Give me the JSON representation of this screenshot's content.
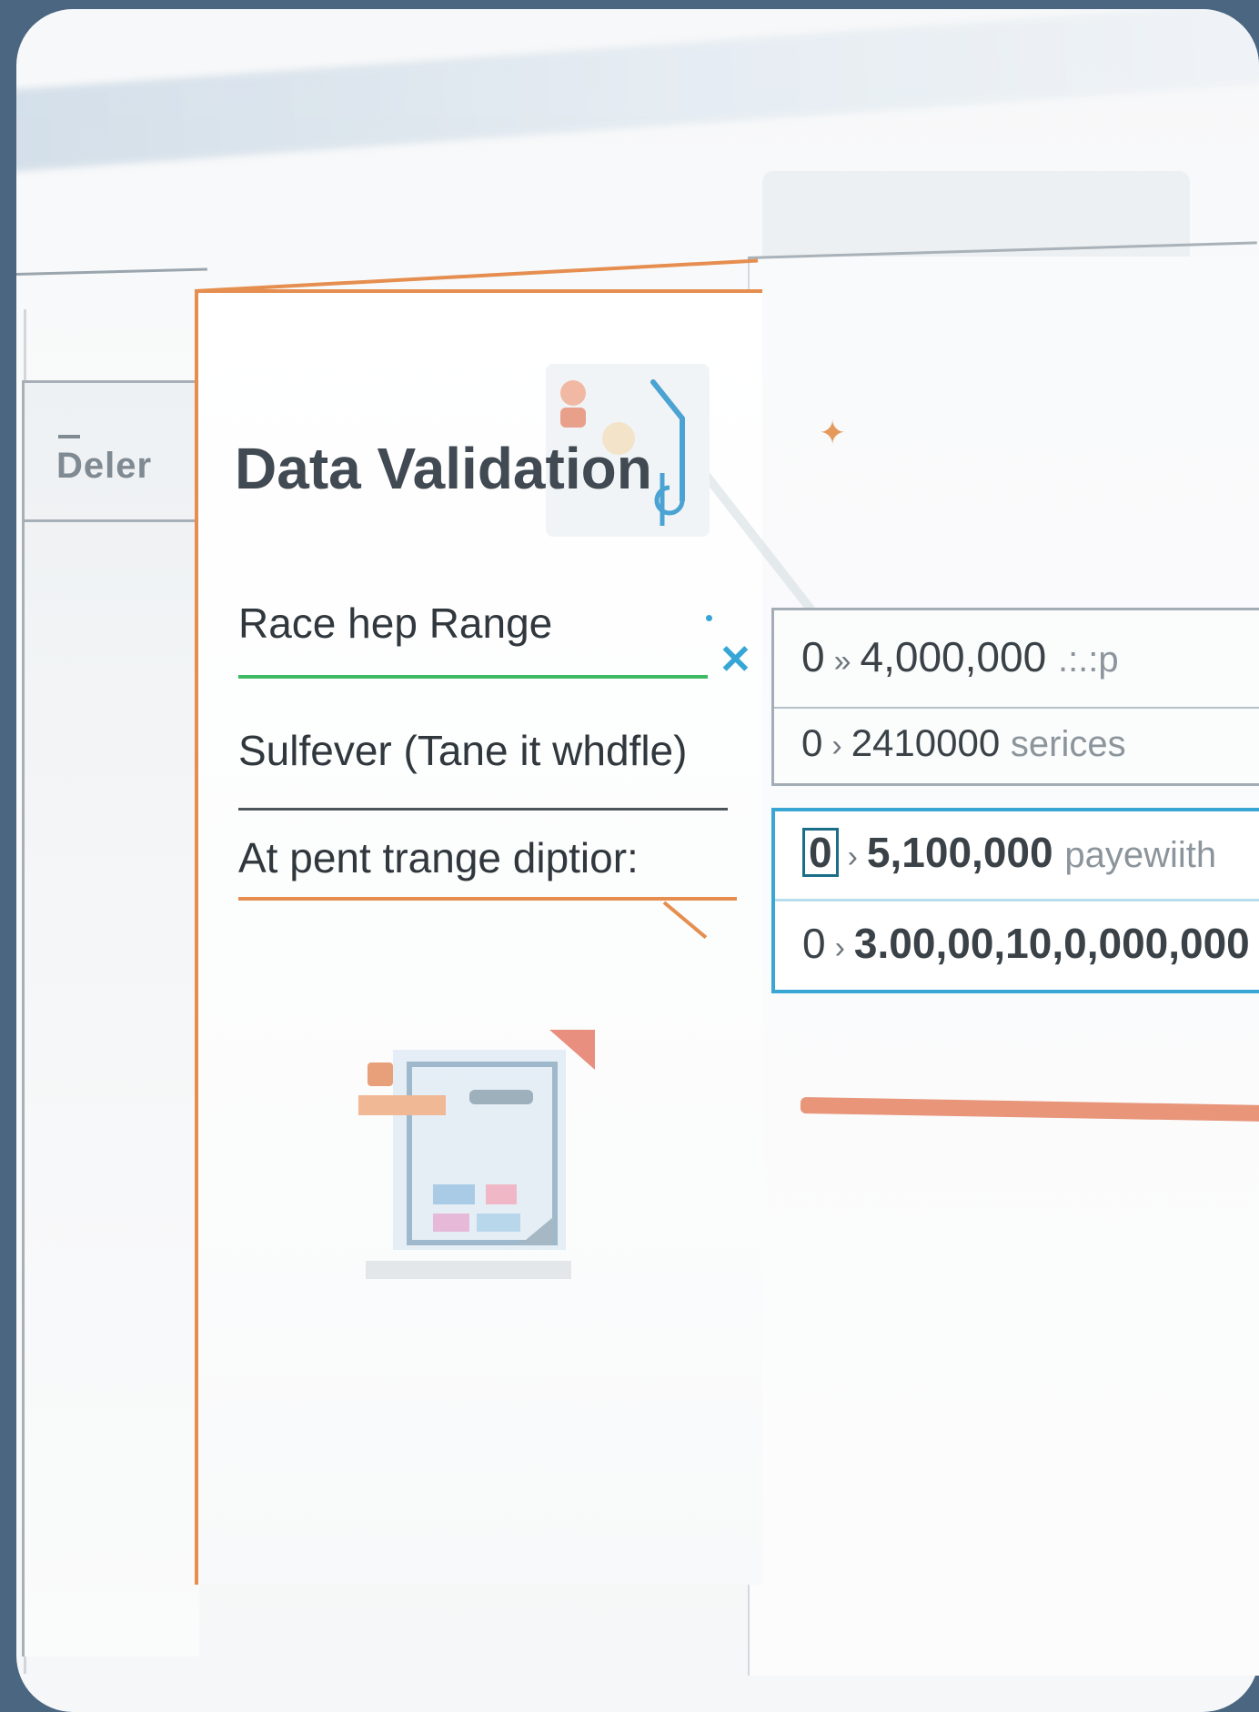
{
  "left_tab": {
    "label": "Deler"
  },
  "dialog": {
    "title": "Data Validation",
    "fields": [
      {
        "label": "Race hep Range"
      },
      {
        "label": "Sulfever (Tane it whdfle)"
      },
      {
        "label": "At pent trange diptior:"
      }
    ]
  },
  "ranges": [
    {
      "start": "0",
      "end": "4,000,000",
      "suffix": ".:.:p"
    },
    {
      "start": "0",
      "end": "2410000",
      "suffix": "serices"
    },
    {
      "start": "0",
      "end": "5,100,000",
      "suffix": "payewiith"
    },
    {
      "start": "0",
      "end": "3.00,00,10,0,000,000",
      "suffix": ""
    }
  ],
  "icons": {
    "close": "close-icon",
    "star": "sparkle-icon",
    "thermometer": "thermometer-icon",
    "document": "document-illustration-icon"
  },
  "colors": {
    "background": "#4a6681",
    "accent_orange": "#e58e4f",
    "accent_blue": "#3aa6d4",
    "accent_green": "#3dbb63"
  }
}
